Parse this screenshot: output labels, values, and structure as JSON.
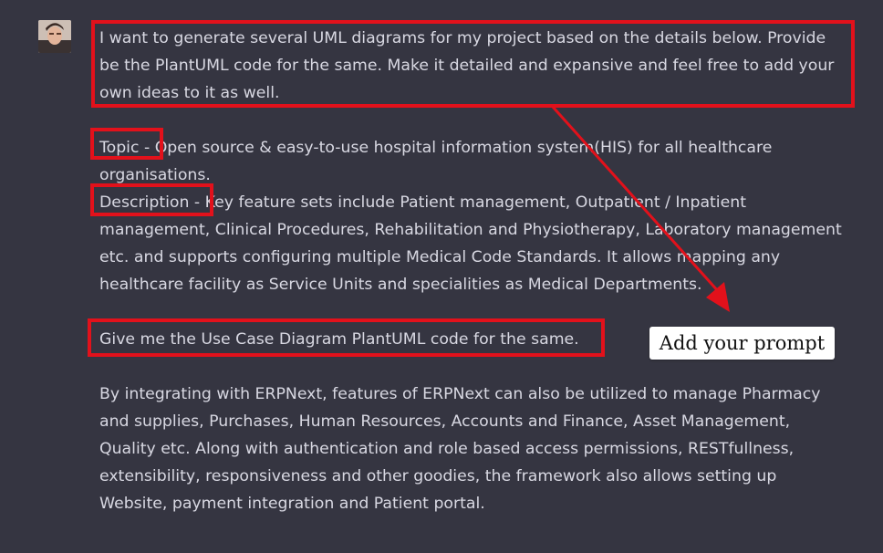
{
  "message": {
    "intro": "I want to generate several UML diagrams for my project based on the details below. Provide be the PlantUML code for the same. Make it detailed and expansive and feel free to add your own ideas to it as well.",
    "topic_label": "Topic -",
    "topic_text": " Open source & easy-to-use hospital information system(HIS) for all healthcare organisations.",
    "description_label": "Description  -",
    "description_text": " Key feature sets include Patient management, Outpatient / Inpatient management, Clinical Procedures, Rehabilitation and Physiotherapy, Laboratory management etc. and supports configuring multiple Medical Code Standards. It allows mapping any healthcare facility as Service Units and specialities as Medical Departments.",
    "ask": "Give me the Use Case Diagram PlantUML code for the same.",
    "extra": "By integrating with ERPNext, features of ERPNext can also be utilized to manage Pharmacy and supplies, Purchases, Human Resources, Accounts and Finance, Asset Management, Quality etc. Along with authentication and role based access permissions, RESTfullness, extensibility, responsiveness and other goodies, the framework also allows setting up Website, payment integration and Patient portal."
  },
  "annotation": {
    "callout_text": "Add your prompt",
    "highlight_color": "#e2111b"
  },
  "colors": {
    "background": "#353541",
    "text": "#d8d8e2"
  },
  "icons": {
    "avatar": "user-avatar-icon"
  }
}
